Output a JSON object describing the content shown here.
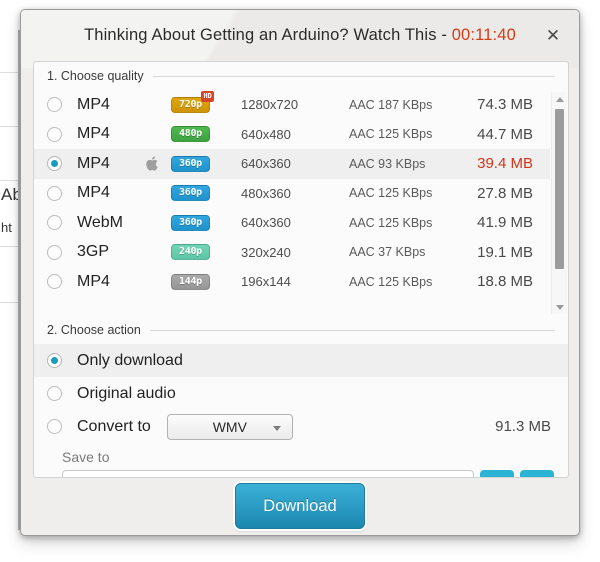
{
  "background": {
    "text_fragments": [
      "Ab",
      "ht"
    ]
  },
  "dialog": {
    "title_main": "Thinking About Getting an Arduino? Watch This - ",
    "title_duration": "00:11:40",
    "close_icon": "close-icon",
    "close_glyph": "✕"
  },
  "quality_section": {
    "heading": "1. Choose quality",
    "rows": [
      {
        "format": "MP4",
        "badge": "720p",
        "badge_color": "gold",
        "hd": "HD",
        "apple": false,
        "resolution": "1280x720",
        "audio": "AAC 187  KBps",
        "size": "74.3 MB",
        "selected": false
      },
      {
        "format": "MP4",
        "badge": "480p",
        "badge_color": "green",
        "hd": "",
        "apple": false,
        "resolution": "640x480",
        "audio": "AAC 125  KBps",
        "size": "44.7 MB",
        "selected": false
      },
      {
        "format": "MP4",
        "badge": "360p",
        "badge_color": "blue",
        "hd": "",
        "apple": true,
        "resolution": "640x360",
        "audio": "AAC 93  KBps",
        "size": "39.4 MB",
        "selected": true
      },
      {
        "format": "MP4",
        "badge": "360p",
        "badge_color": "blue",
        "hd": "",
        "apple": false,
        "resolution": "480x360",
        "audio": "AAC 125  KBps",
        "size": "27.8 MB",
        "selected": false
      },
      {
        "format": "WebM",
        "badge": "360p",
        "badge_color": "blue",
        "hd": "",
        "apple": false,
        "resolution": "640x360",
        "audio": "AAC 125  KBps",
        "size": "41.9 MB",
        "selected": false
      },
      {
        "format": "3GP",
        "badge": "240p",
        "badge_color": "teal",
        "hd": "",
        "apple": false,
        "resolution": "320x240",
        "audio": "AAC 37  KBps",
        "size": "19.1 MB",
        "selected": false
      },
      {
        "format": "MP4",
        "badge": "144p",
        "badge_color": "gray",
        "hd": "",
        "apple": false,
        "resolution": "196x144",
        "audio": "AAC 125  KBps",
        "size": "18.8 MB",
        "selected": false
      }
    ]
  },
  "action_section": {
    "heading": "2. Choose action",
    "only_download": "Only download",
    "original_audio": "Original audio",
    "convert_to": "Convert to",
    "convert_format": "WMV",
    "convert_size": "91.3 MB",
    "save_to_label": "Save to",
    "save_to_value": ""
  },
  "footer": {
    "download_label": "Download"
  },
  "colors": {
    "accent": "#179cbd",
    "highlight_red": "#d2341a",
    "title_red": "#d63b16"
  }
}
